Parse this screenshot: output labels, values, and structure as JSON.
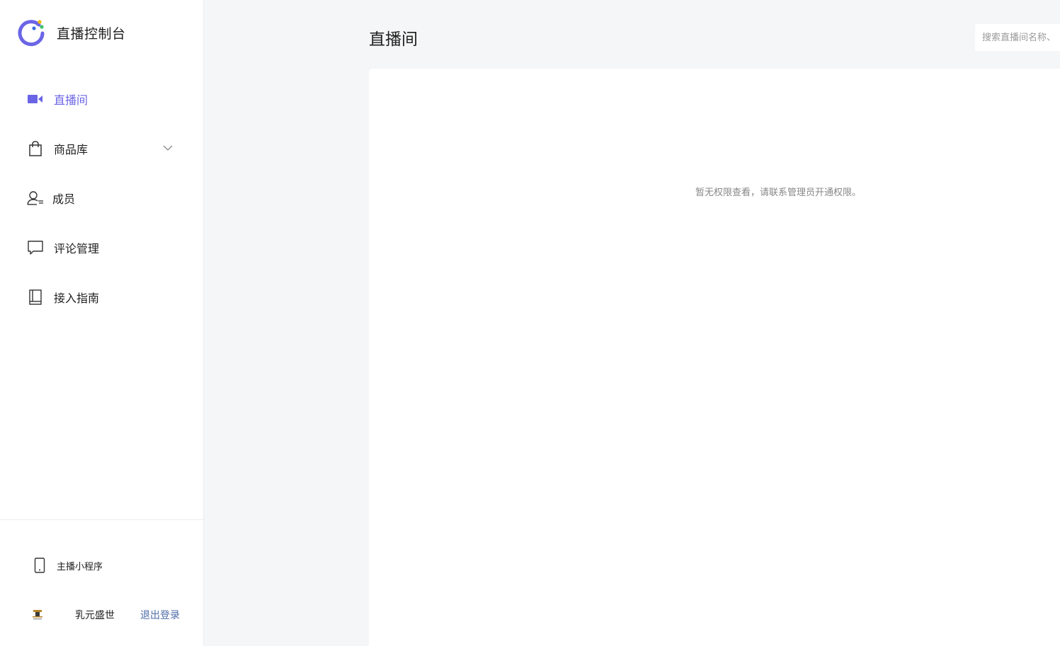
{
  "app": {
    "title": "直播控制台",
    "brand_colors": {
      "ring": "#6b65e6",
      "dot_blue": "#3b6fe0",
      "dot_green": "#3cc26b",
      "dot_yellow": "#f5b800"
    }
  },
  "sidebar": {
    "items": [
      {
        "label": "直播间",
        "icon": "video-camera-icon",
        "active": true
      },
      {
        "label": "商品库",
        "icon": "shopping-bag-icon",
        "has_submenu": true
      },
      {
        "label": "成员",
        "icon": "member-icon"
      },
      {
        "label": "评论管理",
        "icon": "comment-icon"
      },
      {
        "label": "接入指南",
        "icon": "book-icon"
      }
    ],
    "footer": {
      "miniprogram_label": "主播小程序",
      "miniprogram_icon": "phone-icon",
      "username": "乳元盛世",
      "logout_label": "退出登录",
      "avatar_icon": "avatar-icon"
    },
    "active_color": "#6b65e6"
  },
  "main": {
    "title": "直播间",
    "search": {
      "placeholder": "搜索直播间名称、",
      "value": ""
    },
    "empty_message": "暂无权限查看，请联系管理员开通权限。"
  }
}
